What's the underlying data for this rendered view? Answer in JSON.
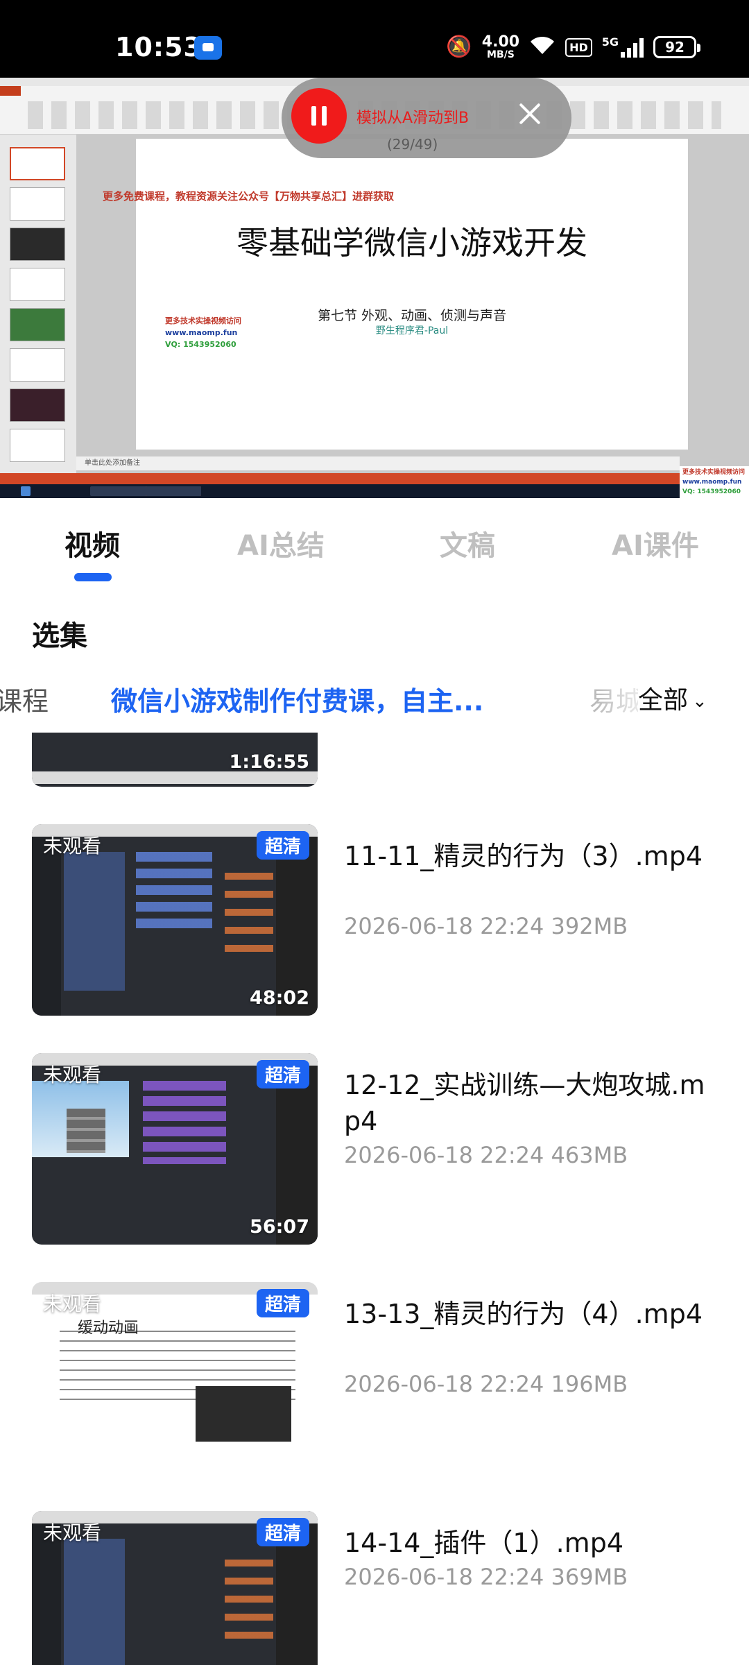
{
  "status_bar": {
    "time": "10:53",
    "net_speed_value": "4.00",
    "net_speed_unit": "MB/S",
    "hd_label": "HD",
    "network": "5G",
    "battery": "92",
    "icons": [
      "app-notification-icon",
      "mute-bell-icon",
      "wifi-icon",
      "signal-icon",
      "battery-icon"
    ]
  },
  "video": {
    "slide_top_note": "更多免费课程，教程资源关注公众号【万物共享总汇】进群获取",
    "slide_title": "零基础学微信小游戏开发",
    "slide_subtitle": "第七节 外观、动画、侦测与声音",
    "slide_author": "野生程序君-Paul",
    "watermark_line1": "更多技术实操视频访问",
    "watermark_line2": "www.maomp.fun",
    "watermark_line3": "VQ: 1543952060",
    "notes_placeholder": "单击此处添加备注"
  },
  "overlay": {
    "label": "模拟从A滑动到B",
    "count": "(29/49)"
  },
  "tabs": [
    {
      "label": "视频",
      "active": true
    },
    {
      "label": "AI总结",
      "active": false
    },
    {
      "label": "文稿",
      "active": false
    },
    {
      "label": "AI课件",
      "active": false
    }
  ],
  "section_title": "选集",
  "collections": {
    "items": [
      "课程",
      "微信小游戏制作付费课，自主...",
      "易城"
    ],
    "all_label": "全部"
  },
  "episodes": [
    {
      "duration": "1:16:55"
    },
    {
      "title": "11-11_精灵的行为（3）.mp4",
      "meta": "2026-06-18 22:24 392MB",
      "duration": "48:02",
      "watched": "未观看",
      "quality": "超清"
    },
    {
      "title": "12-12_实战训练—大炮攻城.mp4",
      "meta": "2026-06-18 22:24 463MB",
      "duration": "56:07",
      "watched": "未观看",
      "quality": "超清"
    },
    {
      "title": "13-13_精灵的行为（4）.mp4",
      "meta": "2026-06-18 22:24 196MB",
      "watched": "未观看",
      "quality": "超清",
      "thumb_title": "缓动动画"
    },
    {
      "title": "14-14_插件（1）.mp4",
      "meta": "2026-06-18 22:24 369MB",
      "watched": "未观看",
      "quality": "超清"
    }
  ],
  "colors": {
    "accent": "#1d64f2",
    "record": "#f01b1b",
    "overlay_text": "#e81e1e"
  }
}
